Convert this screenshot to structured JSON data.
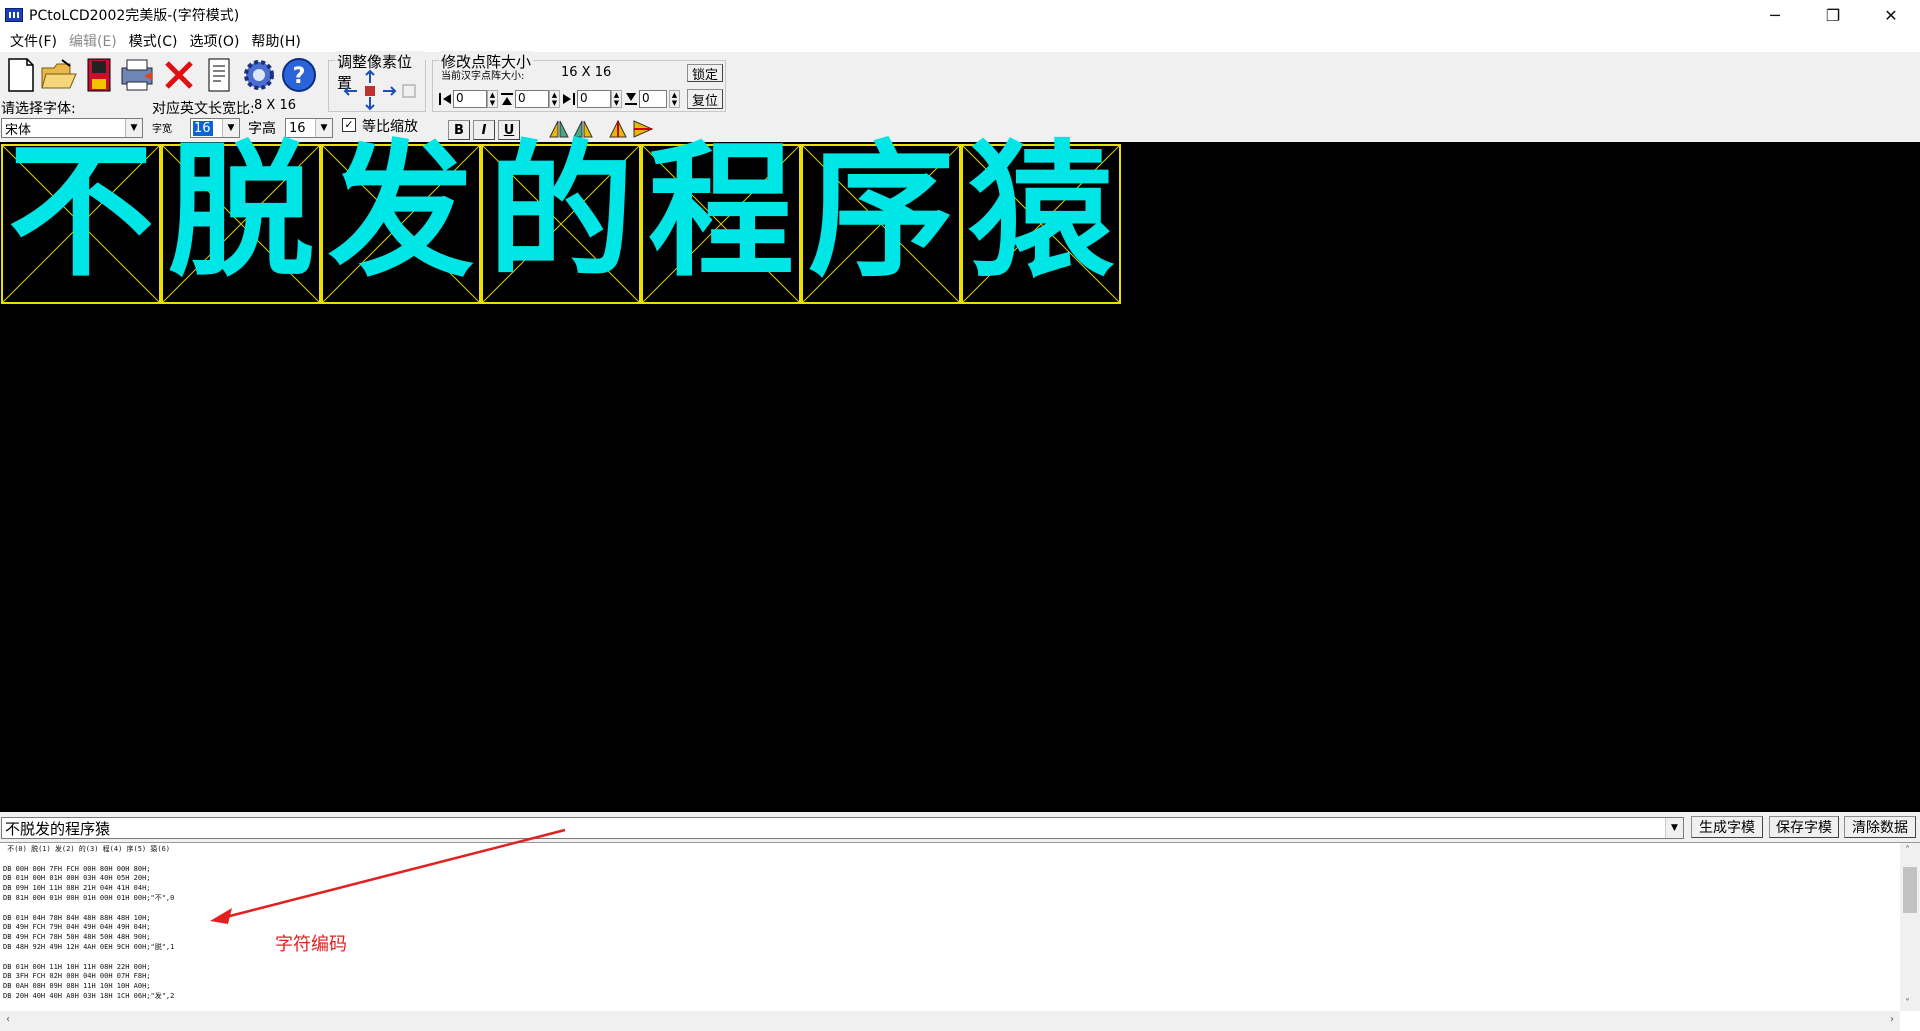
{
  "window": {
    "title": "PCtoLCD2002完美版-(字符模式)",
    "minimize": "─",
    "restore": "❐",
    "close": "✕"
  },
  "menu": [
    {
      "label": "文件(F)",
      "enabled": true
    },
    {
      "label": "编辑(E)",
      "enabled": false
    },
    {
      "label": "模式(C)",
      "enabled": true
    },
    {
      "label": "选项(O)",
      "enabled": true
    },
    {
      "label": "帮助(H)",
      "enabled": true
    }
  ],
  "toolbar": {
    "icons": [
      "new-file-icon",
      "open-folder-icon",
      "save-icon",
      "print-icon",
      "delete-icon",
      "notes-icon",
      "settings-gear-icon",
      "help-icon"
    ],
    "font_label": "请选择字体:",
    "font_value": "宋体",
    "ratio_label": "对应英文长宽比:",
    "ratio_value": "8 X 16",
    "width_label": "字宽",
    "width_value": "16",
    "height_label": "字高",
    "height_value": "16",
    "keep_ratio_label": "等比缩放",
    "keep_ratio_checked": true,
    "bold": "B",
    "italic": "I",
    "underline": "U",
    "pixel_group_title": "调整像素位置",
    "matrix_group_title": "修改点阵大小",
    "current_size_label": "当前汉字点阵大小:",
    "current_size_value": "16 X 16",
    "lock_button": "锁定",
    "reset_button": "复位",
    "spin_values": [
      "0",
      "0",
      "0",
      "0"
    ]
  },
  "characters": [
    "不",
    "脱",
    "发",
    "的",
    "程",
    "序",
    "猿"
  ],
  "input": {
    "text": "不脱发的程序猿",
    "generate_button": "生成字模",
    "save_button": "保存字模",
    "clear_button": "清除数据"
  },
  "output": {
    "lines": [
      " 不(0) 脱(1) 发(2) 的(3) 程(4) 序(5) 猿(6)",
      "",
      "DB 00H 00H 7FH FCH 00H 80H 00H 80H;",
      "DB 01H 00H 01H 00H 03H 40H 05H 20H;",
      "DB 09H 10H 11H 08H 21H 04H 41H 04H;",
      "DB 81H 00H 01H 00H 01H 00H 01H 00H;\"不\",0",
      "",
      "DB 01H 04H 78H 84H 48H 88H 48H 10H;",
      "DB 49H FCH 79H 04H 49H 04H 49H 04H;",
      "DB 49H FCH 78H 50H 48H 50H 48H 90H;",
      "DB 48H 92H 49H 12H 4AH 0EH 9CH 00H;\"脱\",1",
      "",
      "DB 01H 00H 11H 10H 11H 08H 22H 00H;",
      "DB 3FH FCH 02H 00H 04H 00H 07H F8H;",
      "DB 0AH 08H 09H 08H 11H 10H 10H A0H;",
      "DB 20H 40H 40H A0H 03H 18H 1CH 06H;\"发\",2"
    ]
  },
  "annotation": "字符编码",
  "colors": {
    "canvas_bg": "#000000",
    "pixel": "#00e5e5",
    "grid_border": "#e8e000",
    "annotation": "#e32020"
  }
}
